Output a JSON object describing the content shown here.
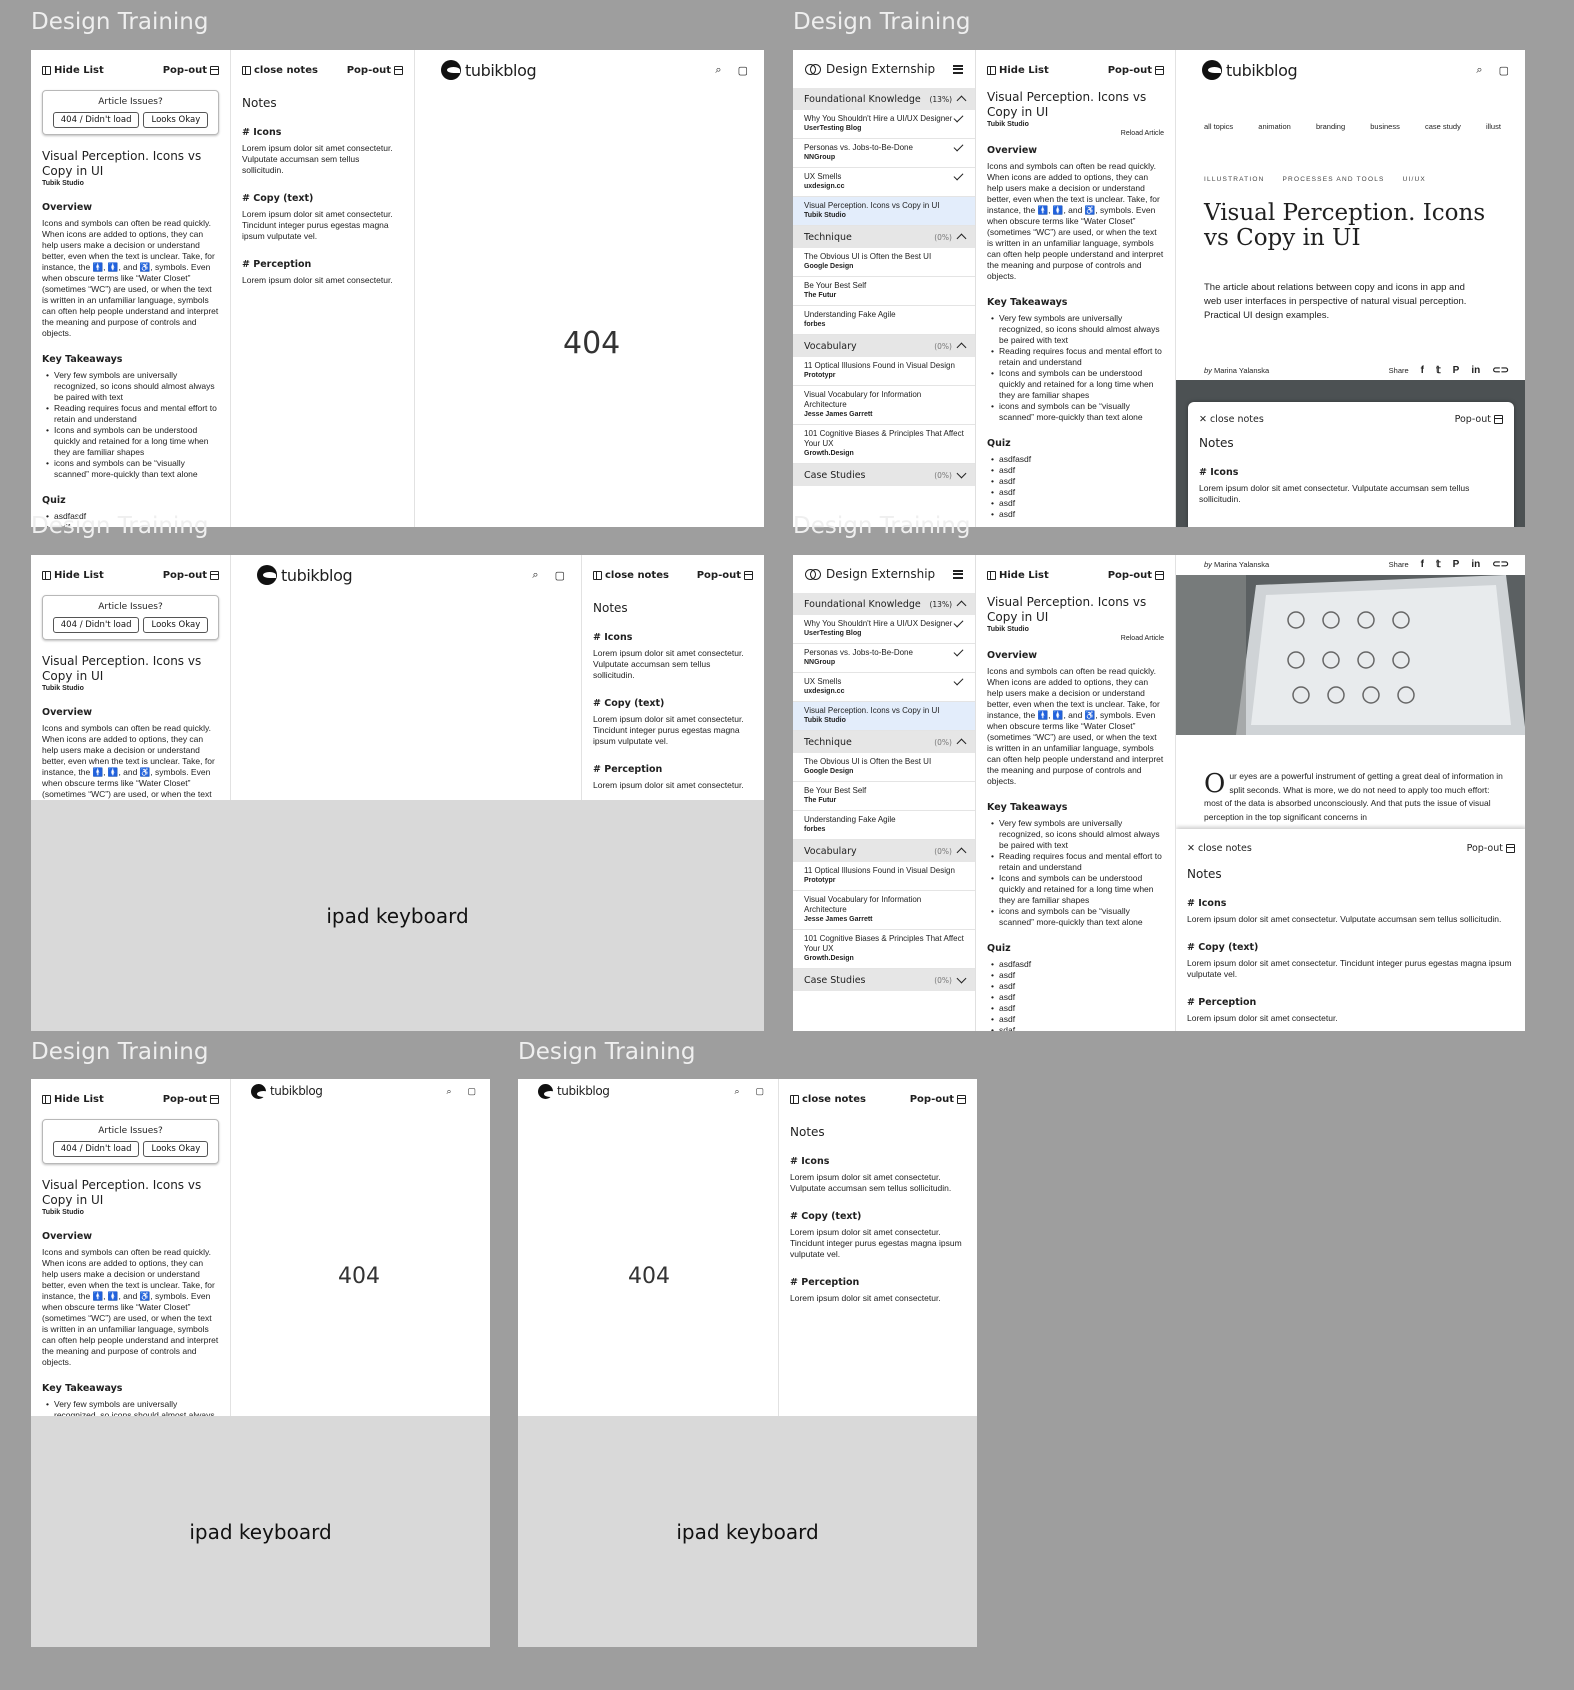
{
  "frame_titles": [
    "Design Training",
    "Design Training",
    "Design Training",
    "Design Training",
    "Design Training",
    "Design Training"
  ],
  "toolbar": {
    "hide_list": "Hide List",
    "pop_out": "Pop-out",
    "close_notes": "close notes",
    "x_close_notes": "✕ close notes"
  },
  "issues": {
    "title": "Article Issues?",
    "btn_404": "404 / Didn't load",
    "btn_ok": "Looks Okay"
  },
  "article": {
    "title": "Visual Perception. Icons vs Copy in UI",
    "source": "Tubik Studio",
    "reload": "Reload Article",
    "overview_h": "Overview",
    "overview": "Icons and symbols can often be read quickly. When icons are added to options, they can help users make a decision or understand better, even when the text is unclear. Take, for instance, the 🚹, 🚺, and ♿, symbols. Even when obscure terms like “Water Closet” (sometimes “WC”) are used, or when the text is written in an unfamiliar language, symbols can often help people understand and interpret the meaning and purpose of controls and objects.",
    "takeaways_h": "Key Takeaways",
    "takeaways": [
      "Very few symbols are universally recognized, so icons should almost always be paired with text",
      "Reading requires focus and mental effort to retain and understand",
      "Icons and symbols can be understood quickly and retained for a long time when they are familiar shapes",
      "icons and symbols can be “visually scanned” more-quickly than text alone"
    ],
    "quiz_h": "Quiz",
    "quiz": [
      "asdfasdf",
      "asdf",
      "asdf",
      "asdf",
      "asdf",
      "asdf",
      "sdaf"
    ]
  },
  "notes": {
    "heading": "Notes",
    "icons_h": "# Icons",
    "icons_b": "Lorem ipsum dolor sit amet consectetur. Vulputate accumsan sem tellus sollicitudin.",
    "copy_h": "# Copy (text)",
    "copy_b": "Lorem ipsum dolor sit amet consectetur. Tincidunt integer purus egestas magna ipsum vulputate vel.",
    "perc_h": "# Perception",
    "perc_b": "Lorem ipsum dolor sit amet consectetur."
  },
  "blog": {
    "logo": "tubikblog",
    "search_icon": "⌕",
    "bag_icon": "▢"
  },
  "err": "404",
  "keyboard": "ipad keyboard",
  "sidebar": {
    "title": "Design Externship",
    "categories": [
      {
        "name": "Foundational Knowledge",
        "pct": "(13%)",
        "items": [
          {
            "t": "Why You Shouldn't Hire a UI/UX Designer",
            "s": "UserTesting Blog",
            "done": true
          },
          {
            "t": "Personas vs. Jobs-to-Be-Done",
            "s": "NNGroup",
            "done": true
          },
          {
            "t": "UX Smells",
            "s": "uxdesign.cc",
            "done": true
          },
          {
            "t": "Visual Perception. Icons vs Copy in UI",
            "s": "Tubik Studio",
            "done": false,
            "sel": true
          }
        ]
      },
      {
        "name": "Technique",
        "pct": "(0%)",
        "items": [
          {
            "t": "The Obvious UI is Often the Best UI",
            "s": "Google Design"
          },
          {
            "t": "Be Your Best Self",
            "s": "The Futur"
          },
          {
            "t": "Understanding Fake Agile",
            "s": "forbes"
          }
        ]
      },
      {
        "name": "Vocabulary",
        "pct": "(0%)",
        "items": [
          {
            "t": "11 Optical Illusions Found in Visual Design",
            "s": "Prototypr"
          },
          {
            "t": "Visual Vocabulary for Information Architecture",
            "s": "Jesse James Garrett"
          },
          {
            "t": "101 Cognitive Biases & Principles That Affect Your UX",
            "s": "Growth.Design"
          }
        ]
      },
      {
        "name": "Case Studies",
        "pct": "(0%)",
        "items": []
      }
    ]
  },
  "blogpage": {
    "topics": [
      "all topics",
      "animation",
      "branding",
      "business",
      "case study",
      "illust"
    ],
    "tags": [
      "ILLUSTRATION",
      "PROCESSES AND TOOLS",
      "UI/UX"
    ],
    "title": "Visual Perception. Icons vs Copy in UI",
    "lede": "The article about relations between copy and icons in app and web user interfaces in perspective of natural visual perception. Practical UI design examples.",
    "by": "by",
    "author": "Marina Yalanska",
    "share": "Share",
    "share_icons": [
      "f",
      "𝕥",
      "P",
      "in",
      "⊂⊃"
    ],
    "drop": "O",
    "body": "ur eyes are a powerful instrument of getting a great deal of information in split seconds. What is more, we do not need to apply too much effort: most of the data is absorbed unconsciously. And that puts the issue of visual perception in the top significant concerns in"
  }
}
